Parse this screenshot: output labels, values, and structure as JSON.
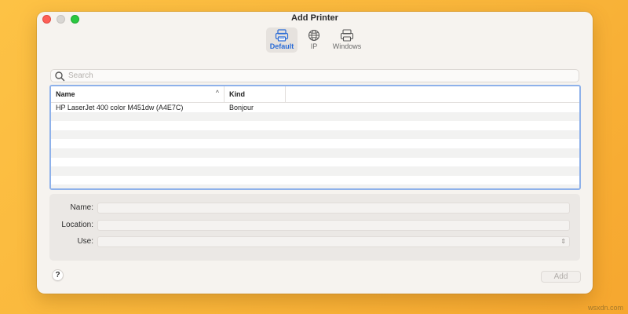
{
  "window": {
    "title": "Add Printer"
  },
  "toolbar": {
    "default_label": "Default",
    "ip_label": "IP",
    "windows_label": "Windows"
  },
  "search": {
    "placeholder": "Search",
    "value": ""
  },
  "table": {
    "columns": [
      "Name",
      "Kind"
    ],
    "rows": [
      {
        "name": "HP LaserJet 400 color M451dw (A4E7C)",
        "kind": "Bonjour"
      }
    ]
  },
  "form": {
    "name_label": "Name:",
    "location_label": "Location:",
    "use_label": "Use:",
    "name_value": "",
    "location_value": "",
    "use_value": ""
  },
  "buttons": {
    "help": "?",
    "add": "Add"
  },
  "watermark": "wsxdn.com",
  "colors": {
    "accent": "#2a6bd6",
    "selection_border": "#8eb1ea",
    "background": "#f9b53a"
  }
}
